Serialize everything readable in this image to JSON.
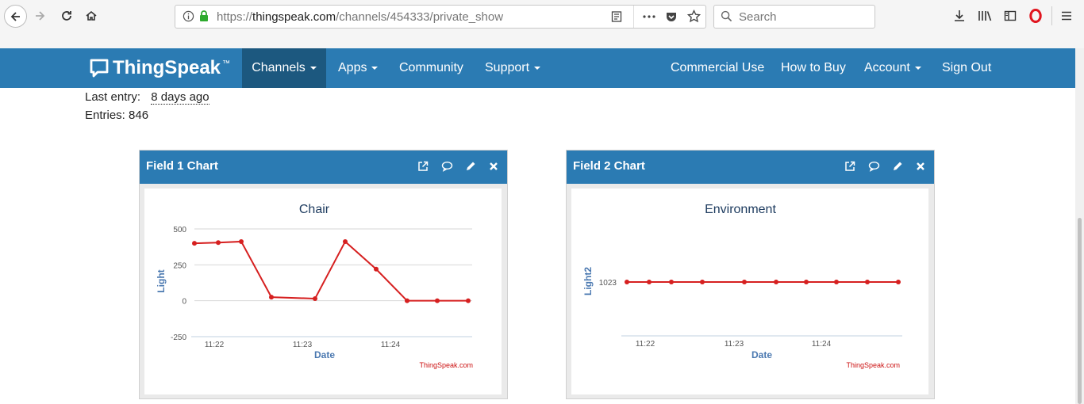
{
  "browser": {
    "url_prefix": "https://",
    "url_domain": "thingspeak.com",
    "url_path": "/channels/454333/private_show",
    "search_placeholder": "Search"
  },
  "navbar": {
    "brand": "ThingSpeak",
    "brand_tm": "™",
    "items": [
      "Channels",
      "Apps",
      "Community",
      "Support"
    ],
    "right_items": [
      "Commercial Use",
      "How to Buy",
      "Account",
      "Sign Out"
    ]
  },
  "channel": {
    "last_entry_label": "Last entry:",
    "last_entry_value": "8 days ago",
    "entries_label": "Entries: 846"
  },
  "panels": [
    {
      "title": "Field 1 Chart"
    },
    {
      "title": "Field 2 Chart"
    }
  ],
  "chart_data": [
    {
      "type": "line",
      "title": "Chair",
      "xlabel": "Date",
      "ylabel": "Light",
      "credit": "ThingSpeak.com",
      "x_ticks": [
        "11:22",
        "11:23",
        "11:24"
      ],
      "y_ticks": [
        500,
        250,
        0,
        -250
      ],
      "ylim": [
        -250,
        500
      ],
      "grid": true,
      "color": "#d62020",
      "series": [
        {
          "values": [
            400,
            405,
            412,
            25,
            15,
            412,
            220,
            0,
            0,
            0
          ]
        }
      ]
    },
    {
      "type": "line",
      "title": "Environment",
      "xlabel": "Date",
      "ylabel": "Light2",
      "credit": "ThingSpeak.com",
      "x_ticks": [
        "11:22",
        "11:23",
        "11:24"
      ],
      "y_ticks": [
        1023
      ],
      "grid": false,
      "color": "#d62020",
      "series": [
        {
          "values": [
            1023,
            1023,
            1023,
            1023,
            1023,
            1023,
            1023,
            1023,
            1023,
            1023
          ]
        }
      ]
    }
  ]
}
